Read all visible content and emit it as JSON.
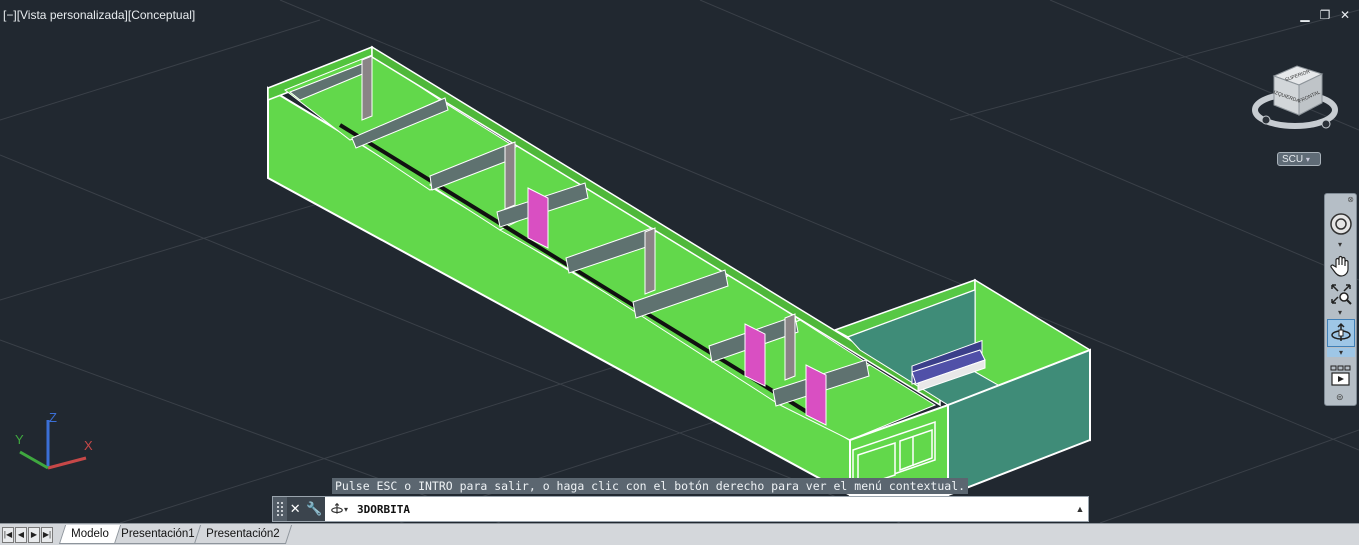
{
  "viewport": {
    "label_parts": [
      "[−]",
      "[Vista personalizada]",
      "[Conceptual]"
    ],
    "controls": {
      "minimize": "▁",
      "restore": "❐",
      "close": "✕"
    }
  },
  "viewcube": {
    "faces": {
      "top": "SUPERIOR",
      "left": "IZQUIERDA",
      "front": "FRONTAL"
    }
  },
  "ucs_menu": "SCU",
  "ucs_axes": {
    "x": "X",
    "y": "Y",
    "z": "Z"
  },
  "navbar": {
    "tools": [
      "steeringwheel-icon",
      "pan-icon",
      "zoom-icon",
      "orbit-icon",
      "showmotion-icon"
    ]
  },
  "command": {
    "prompt": "Pulse ESC o INTRO para salir, o haga clic con el botón derecho para ver el menú contextual.",
    "input": "3DORBITA"
  },
  "status": {
    "tabs": [
      {
        "label": "Modelo",
        "active": true
      },
      {
        "label": "Presentación1",
        "active": false
      },
      {
        "label": "Presentación2",
        "active": false
      }
    ]
  },
  "colors": {
    "background": "#212830",
    "wall_green": "#62d84b",
    "wall_teal": "#3f8c78",
    "beam": "#5f7270",
    "door_pink": "#d94fc2"
  }
}
